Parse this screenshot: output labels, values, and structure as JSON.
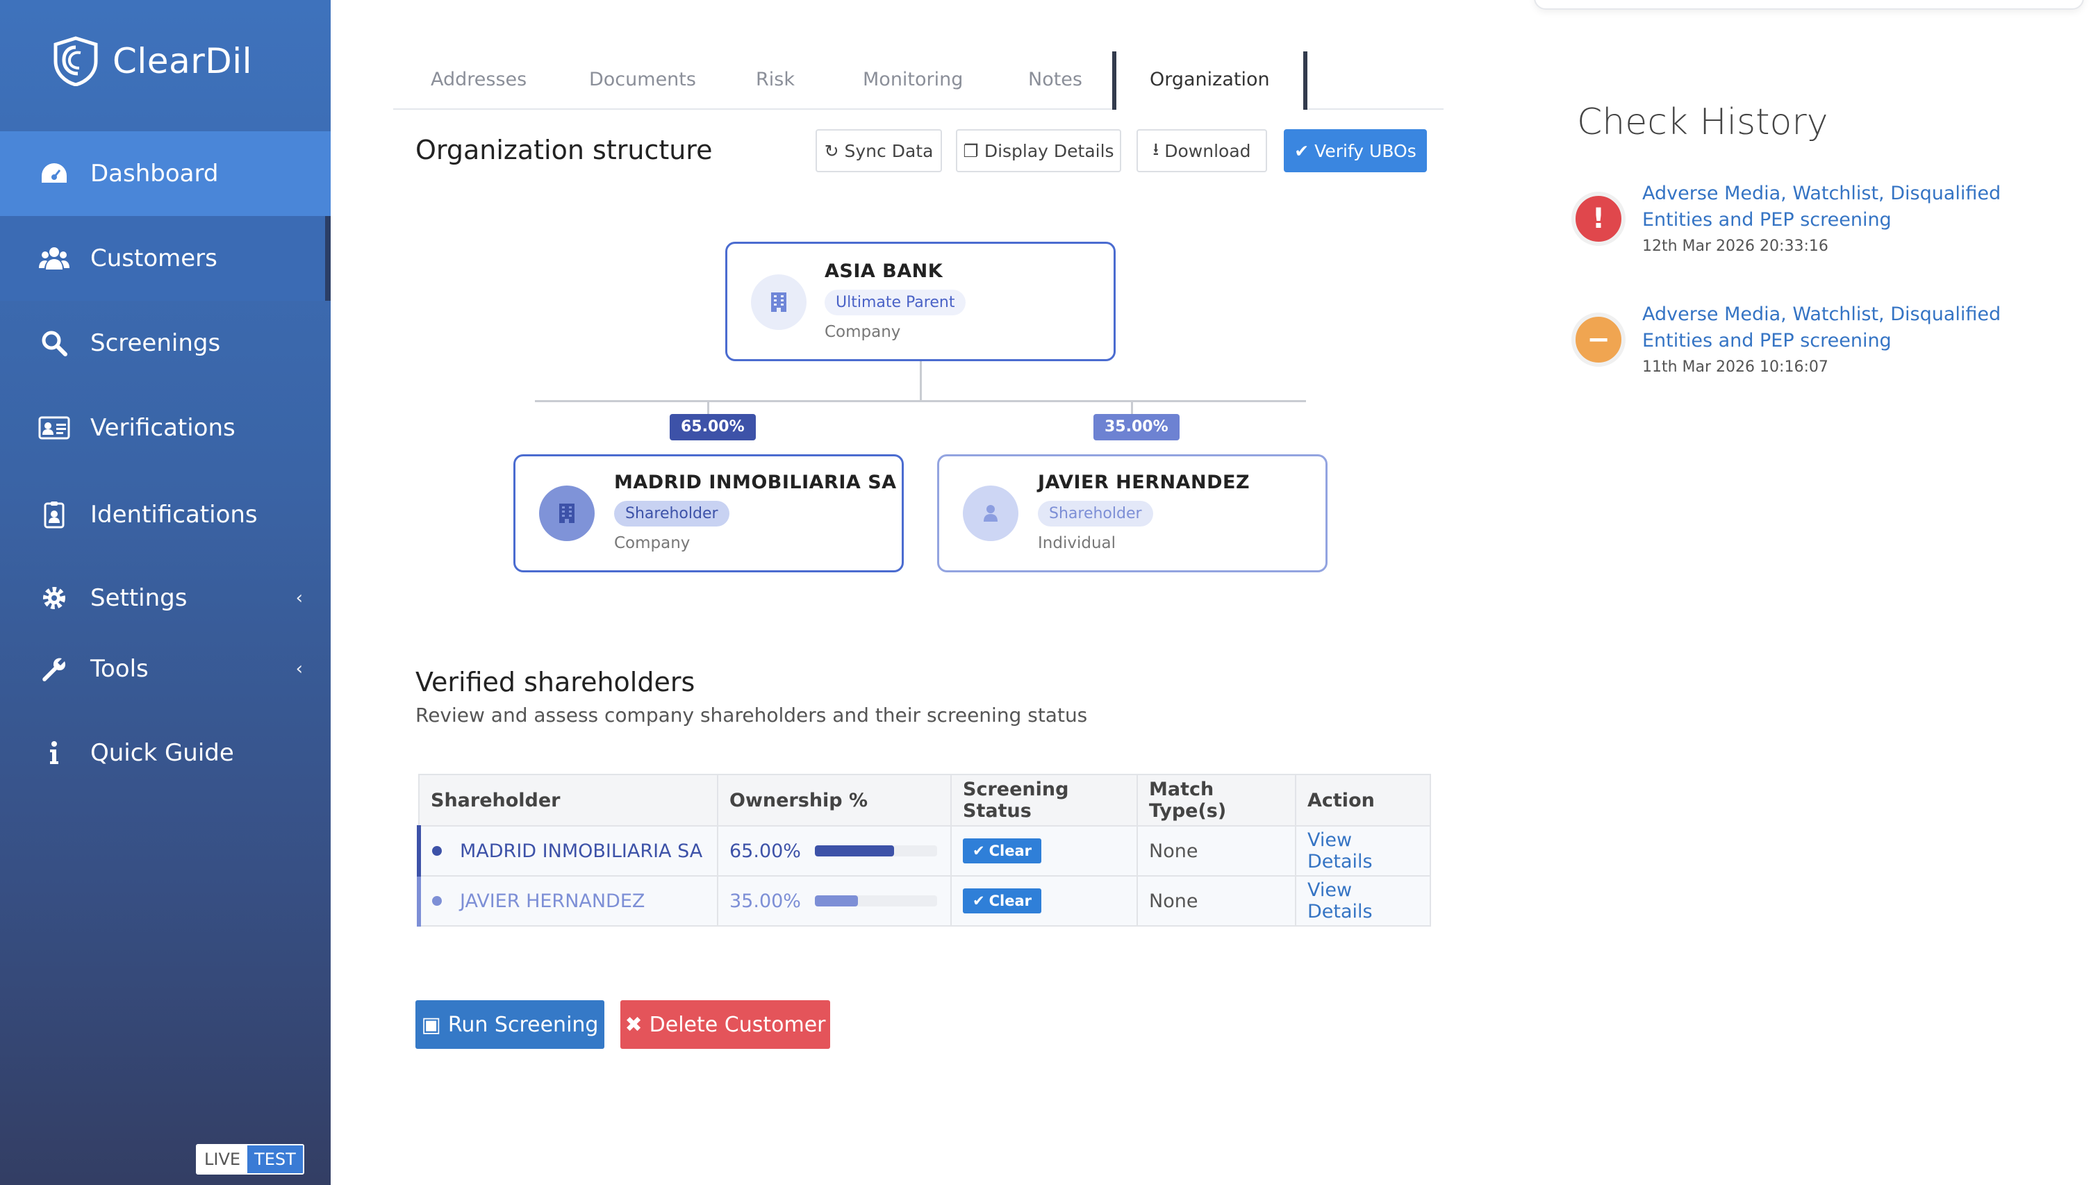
{
  "brand": {
    "name": "ClearDil"
  },
  "sidebar": {
    "items": [
      {
        "label": "Dashboard",
        "icon": "dashboard-icon"
      },
      {
        "label": "Customers",
        "icon": "users-icon"
      },
      {
        "label": "Screenings",
        "icon": "search-icon"
      },
      {
        "label": "Verifications",
        "icon": "id-card-icon"
      },
      {
        "label": "Identifications",
        "icon": "badge-icon"
      },
      {
        "label": "Settings",
        "icon": "gear-icon"
      },
      {
        "label": "Tools",
        "icon": "wrench-icon"
      },
      {
        "label": "Quick Guide",
        "icon": "info-icon"
      }
    ],
    "env": {
      "live": "LIVE",
      "test": "TEST"
    }
  },
  "tabs": [
    "Addresses",
    "Documents",
    "Risk",
    "Monitoring",
    "Notes",
    "Organization"
  ],
  "org": {
    "title": "Organization structure",
    "buttons": {
      "sync": "Sync Data",
      "display": "Display Details",
      "download": "Download",
      "verify": "Verify UBOs"
    },
    "parent": {
      "name": "ASIA BANK",
      "role": "Ultimate Parent",
      "type": "Company"
    },
    "children": [
      {
        "name": "MADRID INMOBILIARIA SA",
        "role": "Shareholder",
        "type": "Company",
        "pct": "65.00%"
      },
      {
        "name": "JAVIER HERNANDEZ",
        "role": "Shareholder",
        "type": "Individual",
        "pct": "35.00%"
      }
    ]
  },
  "shareholders": {
    "title": "Verified shareholders",
    "subtitle": "Review and assess company shareholders and their screening status",
    "columns": [
      "Shareholder",
      "Ownership %",
      "Screening Status",
      "Match Type(s)",
      "Action"
    ],
    "rows": [
      {
        "name": "MADRID INMOBILIARIA SA",
        "ownership": "65.00%",
        "ownership_fraction": 0.65,
        "status": "Clear",
        "match": "None",
        "action": "View Details"
      },
      {
        "name": "JAVIER HERNANDEZ",
        "ownership": "35.00%",
        "ownership_fraction": 0.35,
        "status": "Clear",
        "match": "None",
        "action": "View Details"
      }
    ]
  },
  "actions": {
    "run": "Run Screening",
    "delete": "Delete Customer"
  },
  "history": {
    "title": "Check History",
    "items": [
      {
        "text": "Adverse Media, Watchlist, Disqualified Entities and PEP screening",
        "date": "12th Mar 2026 20:33:16",
        "status": "alert",
        "color": "#e0474c"
      },
      {
        "text": "Adverse Media, Watchlist, Disqualified Entities and PEP screening",
        "date": "11th Mar 2026 10:16:07",
        "status": "warning",
        "color": "#f0a551"
      }
    ]
  },
  "colors": {
    "primary": "#3a86e0",
    "dark_series": "#3d52a8",
    "light_series": "#7d8fd6",
    "danger": "#e4545a"
  }
}
